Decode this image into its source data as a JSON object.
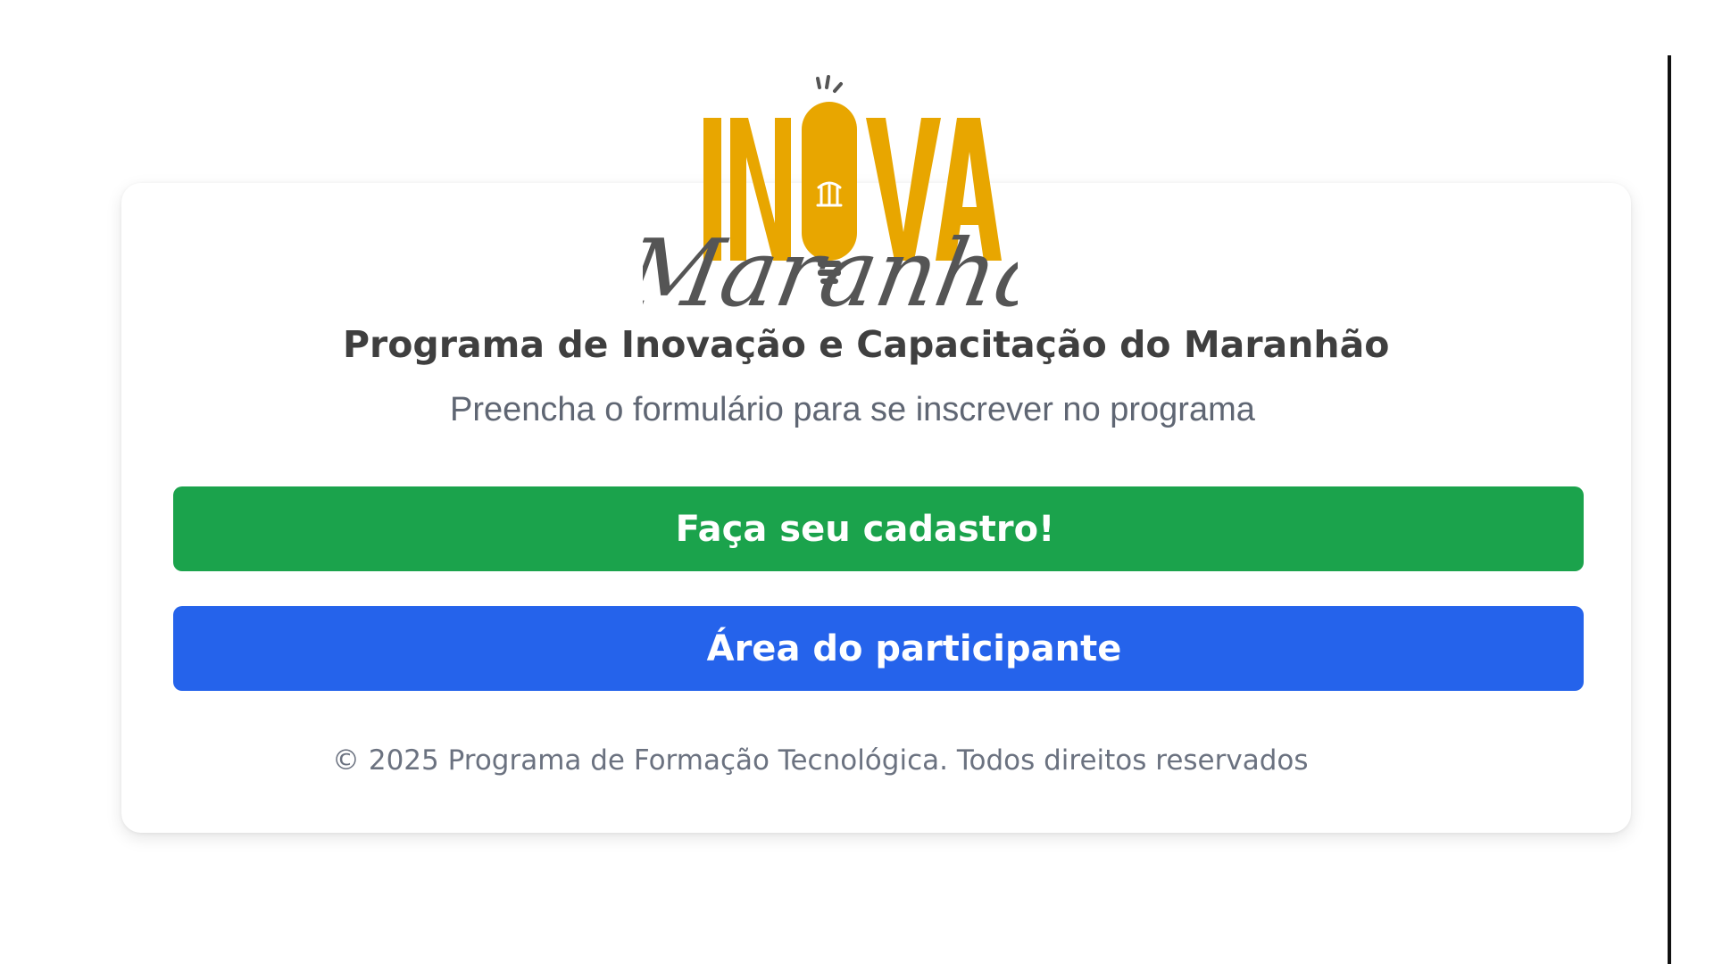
{
  "logo": {
    "word_top": "INOVA",
    "word_script": "Maranhão",
    "icon": "lightbulb-icon",
    "colors": {
      "accent": "#e8a600",
      "dark": "#555555"
    }
  },
  "header": {
    "title": "Programa de Inovação e Capacitação do Maranhão",
    "subtitle": "Preencha o formulário para se inscrever no programa"
  },
  "actions": {
    "register_label": "Faça seu cadastro!",
    "participant_label": "Área do participante"
  },
  "footer": {
    "copyright": "© 2025 Programa de Formação Tecnológica. Todos direitos reservados"
  },
  "colors": {
    "register_button": "#1ba34c",
    "participant_button": "#2563eb",
    "title_text": "#3f3f3f",
    "muted_text": "#6b7280"
  }
}
